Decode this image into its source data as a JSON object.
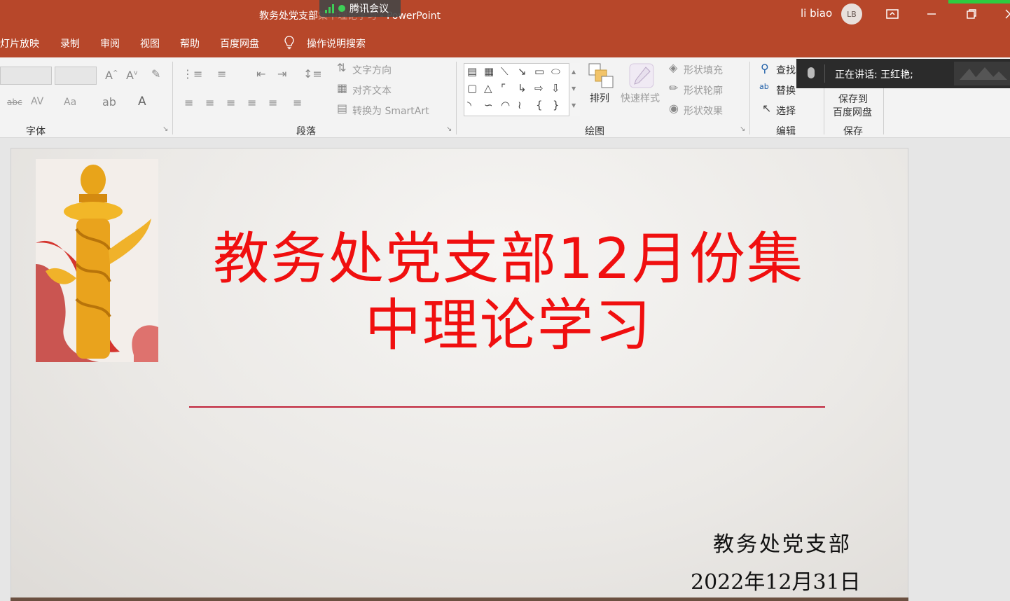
{
  "window": {
    "title_prefix": "教务处党支部",
    "title_hidden": "集中理论学习",
    "title_sep": " - ",
    "app": "PowerPoint",
    "user": "li biao",
    "avatar": "LB",
    "meeting_tag": "腾讯会议"
  },
  "menu": {
    "tabs": [
      "灯片放映",
      "录制",
      "审阅",
      "视图",
      "帮助",
      "百度网盘"
    ],
    "search": "操作说明搜索"
  },
  "ribbon": {
    "groups": {
      "font": "字体",
      "paragraph": "段落",
      "drawing": "绘图",
      "editing": "编辑",
      "save": "保存"
    },
    "paragraph_cmds": {
      "text_direction": "文字方向",
      "align_text": "对齐文本",
      "convert_smartart": "转换为 SmartArt"
    },
    "drawing_cmds": {
      "arrange": "排列",
      "quick_styles": "快速样式",
      "shape_fill": "形状填充",
      "shape_outline": "形状轮廓",
      "shape_effects": "形状效果"
    },
    "editing_cmds": {
      "find": "查找",
      "replace": "替换",
      "select": "选择"
    },
    "save_cmds": {
      "save_to_line1": "保存到",
      "save_to_line2": "百度网盘"
    },
    "font_glyphs": {
      "aa": "Aa",
      "av": "AV",
      "abc": "abc",
      "a": "A"
    }
  },
  "speaker": {
    "label": "正在讲话: 王红艳;"
  },
  "slide": {
    "title_line1": "教务处党支部12月份集",
    "title_line2": "中理论学习",
    "org": "教务处党支部",
    "date": "2022年12月31日"
  },
  "colors": {
    "accent": "#b7472a",
    "title_red": "#f00f0f",
    "rule": "#c0233a"
  }
}
